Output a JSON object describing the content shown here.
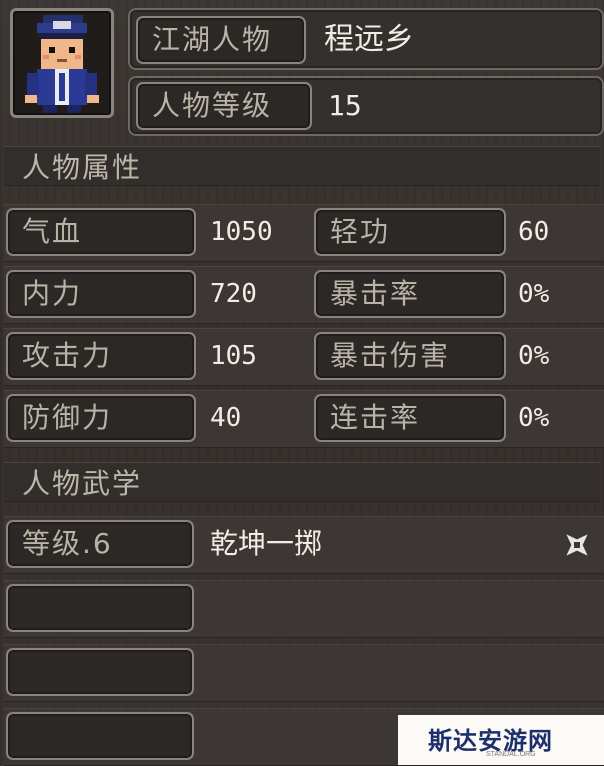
{
  "header": {
    "name_label": "江湖人物",
    "name_value": "程远乡",
    "level_label": "人物等级",
    "level_value": "15"
  },
  "attributes": {
    "title": "人物属性",
    "rows": [
      {
        "left_label": "气血",
        "left_value": "1050",
        "right_label": "轻功",
        "right_value": "60"
      },
      {
        "left_label": "内力",
        "left_value": "720",
        "right_label": "暴击率",
        "right_value": "0%"
      },
      {
        "left_label": "攻击力",
        "left_value": "105",
        "right_label": "暴击伤害",
        "right_value": "0%"
      },
      {
        "left_label": "防御力",
        "left_value": "40",
        "right_label": "连击率",
        "right_value": "0%"
      }
    ]
  },
  "martial": {
    "title": "人物武学",
    "skills": [
      {
        "level_label": "等级.6",
        "name": "乾坤一掷",
        "icon": "shuriken-icon"
      },
      {
        "level_label": "",
        "name": ""
      },
      {
        "level_label": "",
        "name": ""
      },
      {
        "level_label": "",
        "name": ""
      }
    ]
  },
  "watermark": {
    "text": "斯达安游网",
    "sub": "STANDAL.ORG"
  }
}
